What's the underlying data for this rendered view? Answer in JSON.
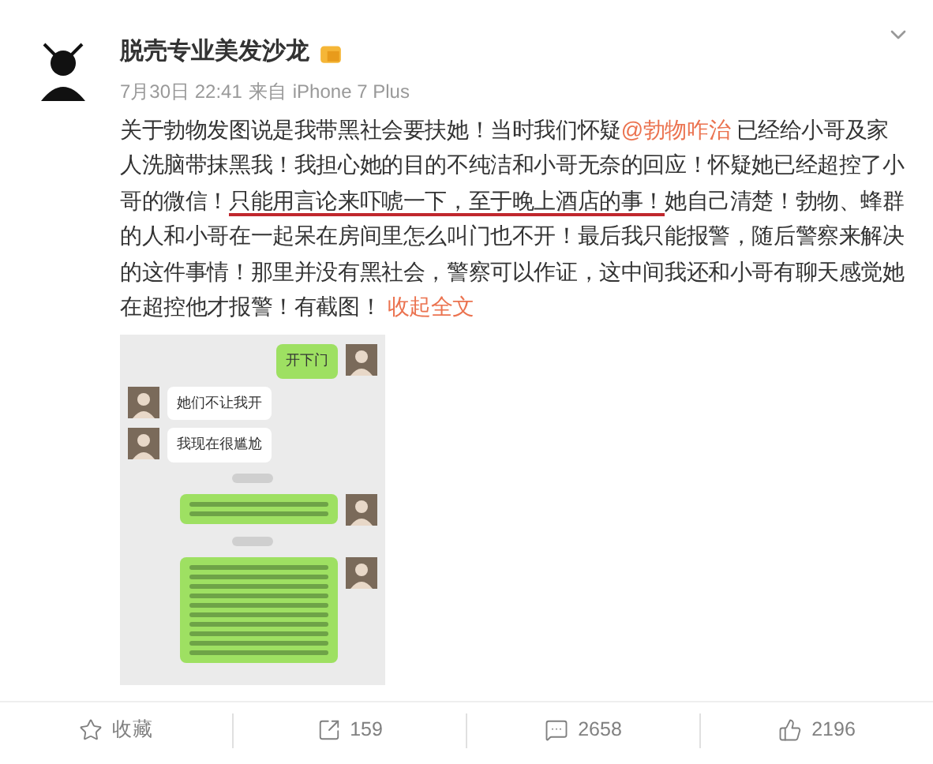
{
  "author": {
    "name": "脱壳专业美发沙龙",
    "verified": true
  },
  "meta": {
    "date": "7月30日 22:41",
    "source_prefix": "来自",
    "source": "iPhone 7 Plus"
  },
  "post": {
    "before": "关于勃物发图说是我带黑社会要扶她！当时我们怀疑",
    "mention": "@勃物咋治",
    "middle": " 已经给小哥及家人洗脑带抹黑我！我担心她的目的不纯洁和小哥无奈的回应！怀疑她已经超控了小哥的微信！",
    "underlined": "只能用言论来吓唬一下，至于晚上酒店的事！",
    "after": "她自己清楚！勃物、蜂群的人和小哥在一起呆在房间里怎么叫门也不开！最后我只能报警，随后警察来解决的这件事情！那里并没有黑社会，警察可以作证，这中间我还和小哥有聊天感觉她在超控他才报警！有截图！",
    "collapse": "收起全文"
  },
  "chat": [
    {
      "kind": "text",
      "outgoing": true,
      "text": "开下门"
    },
    {
      "kind": "text",
      "outgoing": false,
      "text": "她们不让我开"
    },
    {
      "kind": "text",
      "outgoing": false,
      "text": "我现在很尴尬"
    },
    {
      "kind": "time"
    },
    {
      "kind": "blurred",
      "outgoing": true,
      "long": false
    },
    {
      "kind": "time"
    },
    {
      "kind": "blurred",
      "outgoing": true,
      "long": true
    }
  ],
  "actions": [
    {
      "kind": "favorite",
      "label": "收藏"
    },
    {
      "kind": "repost",
      "label": "159"
    },
    {
      "kind": "comment",
      "label": "2658"
    },
    {
      "kind": "like",
      "label": "2196"
    }
  ]
}
